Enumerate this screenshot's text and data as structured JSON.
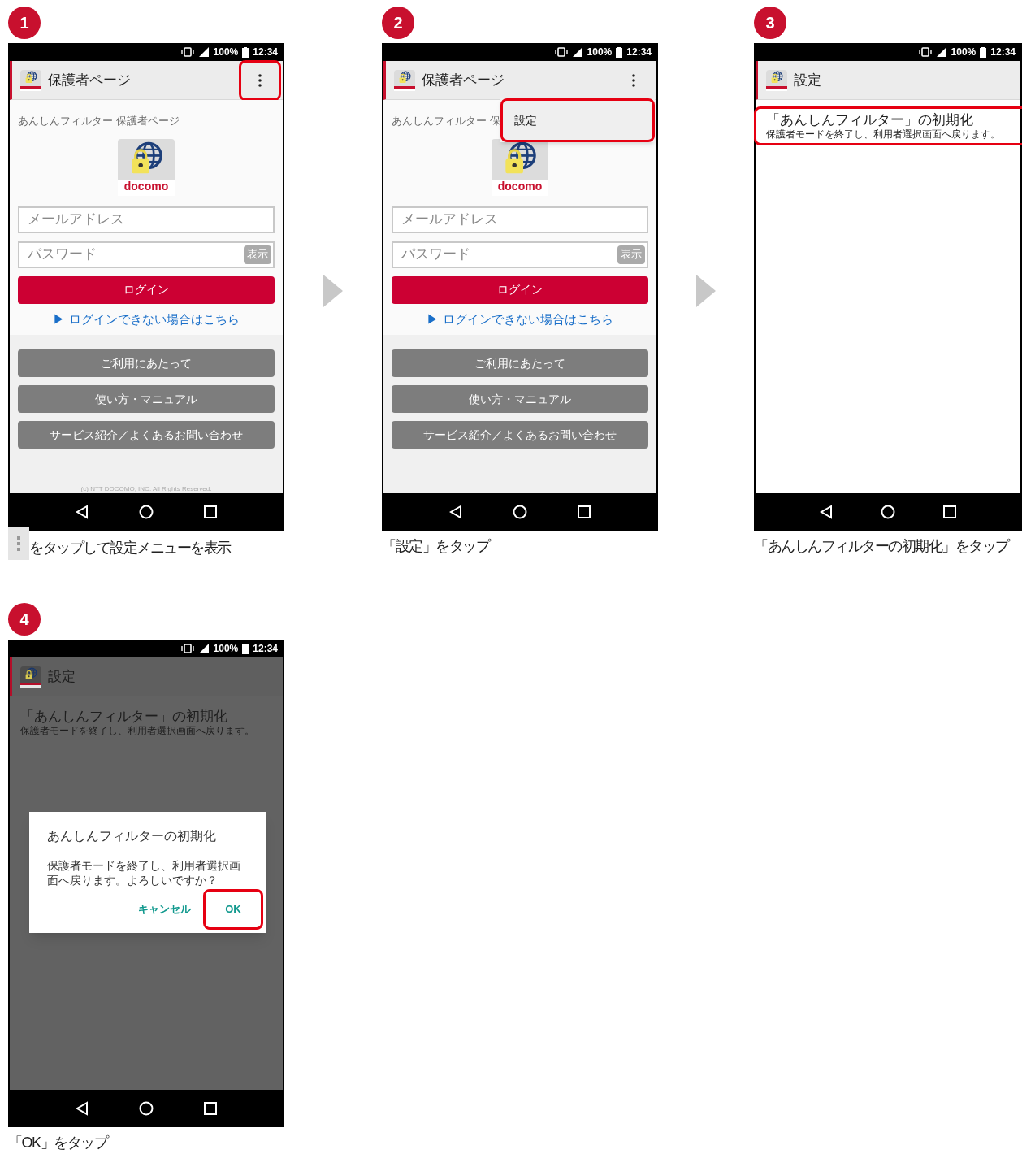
{
  "steps": [
    {
      "number": "1",
      "caption": "をタップして設定メニューを表示",
      "caption_menu_icon": true,
      "screen": {
        "status": {
          "battery": "100%",
          "time": "12:34"
        },
        "appbar": {
          "title": "保護者ページ",
          "menu_button": true,
          "menu_highlighted": true
        },
        "login": {
          "heading": "あんしんフィルター 保護者ページ",
          "logo_text": "docomo",
          "email_placeholder": "メールアドレス",
          "password_placeholder": "パスワード",
          "show_button": "表示",
          "login_button": "ログイン",
          "help_link": "▶ ログインできない場合はこちら",
          "buttons": [
            "ご利用にあたって",
            "使い方・マニュアル",
            "サービス紹介／よくあるお問い合わせ"
          ],
          "copyright": "(c) NTT DOCOMO, INC. All Rights Reserved."
        }
      }
    },
    {
      "number": "2",
      "caption": "「設定」をタップ",
      "screen": {
        "status": {
          "battery": "100%",
          "time": "12:34"
        },
        "appbar": {
          "title": "保護者ページ",
          "menu_button": true,
          "menu_highlighted": false
        },
        "login": {
          "heading": "あんしんフィルター 保",
          "logo_text": "docomo",
          "email_placeholder": "メールアドレス",
          "password_placeholder": "パスワード",
          "show_button": "表示",
          "login_button": "ログイン",
          "help_link": "▶ ログインできない場合はこちら",
          "buttons": [
            "ご利用にあたって",
            "使い方・マニュアル",
            "サービス紹介／よくあるお問い合わせ"
          ]
        },
        "popup_menu": [
          {
            "label": "設定",
            "highlighted": true
          }
        ]
      }
    },
    {
      "number": "3",
      "caption": "「あんしんフィルターの初期化」をタップ",
      "screen": {
        "status": {
          "battery": "100%",
          "time": "12:34"
        },
        "appbar": {
          "title": "設定"
        },
        "settings_items": [
          {
            "title": "「あんしんフィルター」の初期化",
            "description": "保護者モードを終了し、利用者選択画面へ戻ります。",
            "highlighted": true
          }
        ]
      }
    },
    {
      "number": "4",
      "caption": "「OK」をタップ",
      "screen": {
        "status": {
          "battery": "100%",
          "time": "12:34"
        },
        "appbar": {
          "title": "設定"
        },
        "dimmed": true,
        "settings_items": [
          {
            "title": "「あんしんフィルター」の初期化",
            "description": "保護者モードを終了し、利用者選択画面へ戻ります。",
            "highlighted": false
          }
        ],
        "dialog": {
          "title": "あんしんフィルターの初期化",
          "message": "保護者モードを終了し、利用者選択画面へ戻ります。よろしいですか？",
          "buttons": [
            {
              "label": "キャンセル",
              "highlighted": false
            },
            {
              "label": "OK",
              "highlighted": true
            }
          ]
        }
      }
    }
  ]
}
